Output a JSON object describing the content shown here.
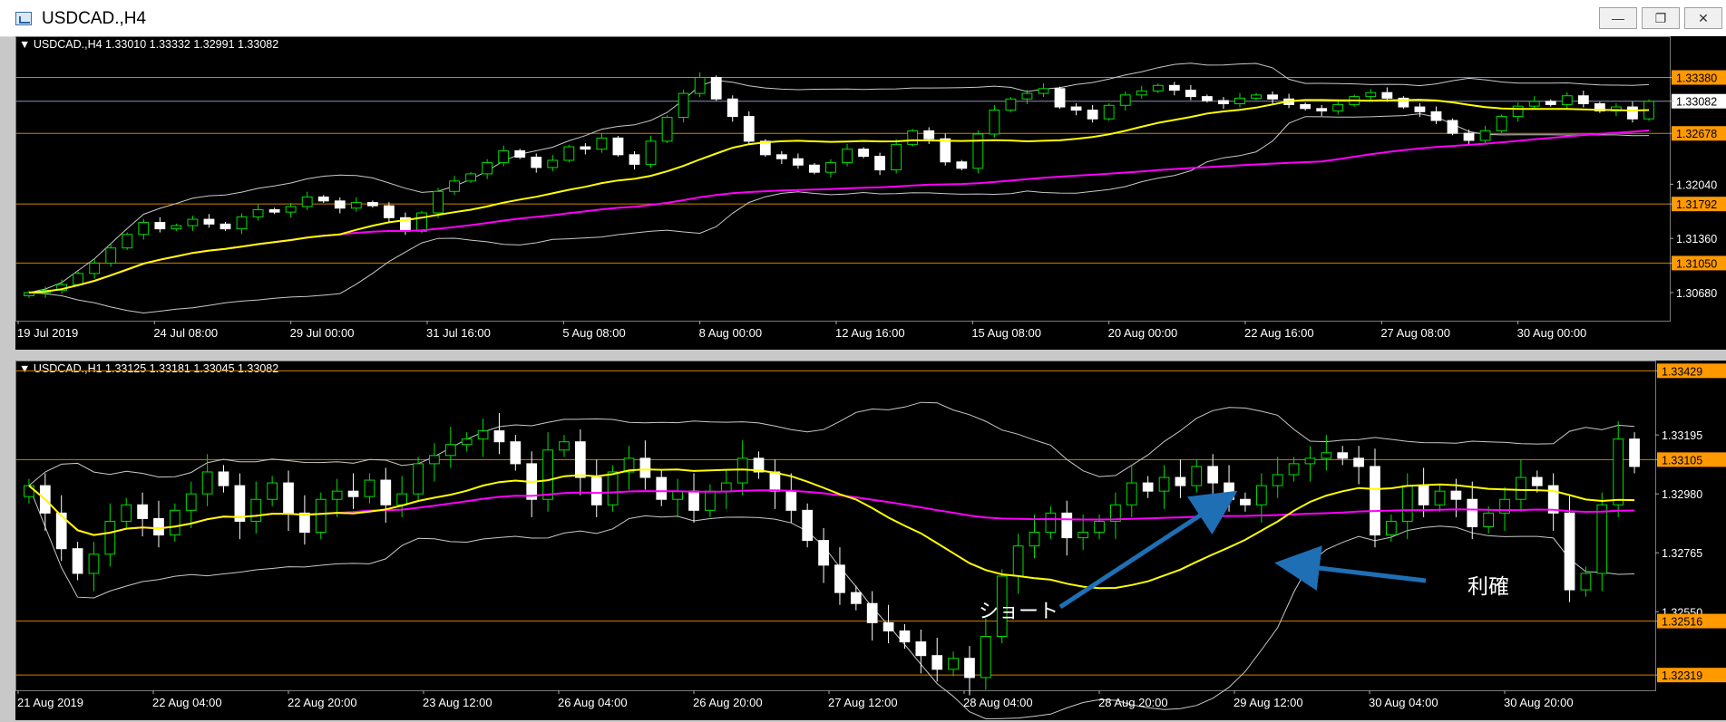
{
  "window": {
    "title": "USDCAD.,H4",
    "buttons": [
      "minimize",
      "restore",
      "close"
    ]
  },
  "annotations": {
    "short_label": "ショート",
    "take_profit_label": "利確"
  },
  "colors": {
    "bull_candle": "#00e000",
    "bear_candle": "#ffffff",
    "ma_fast": "#ffff00",
    "ma_slow": "#ff00ff",
    "bands": "#c8c8c8",
    "level_line": "#d08000",
    "price_box": "#ff9900",
    "arrow": "#1f6fb5"
  },
  "chart_data": [
    {
      "type": "candlestick",
      "header": "USDCAD.,H4  1.33010 1.33332 1.32991 1.33082",
      "x_ticks": [
        "19 Jul 2019",
        "24 Jul 08:00",
        "29 Jul 00:00",
        "31 Jul 16:00",
        "5 Aug 08:00",
        "8 Aug 00:00",
        "12 Aug 16:00",
        "15 Aug 08:00",
        "20 Aug 00:00",
        "22 Aug 16:00",
        "27 Aug 08:00",
        "30 Aug 00:00"
      ],
      "y_ticks": [
        "1.33380",
        "1.33082",
        "1.32678",
        "1.32040",
        "1.31792",
        "1.31360",
        "1.31050",
        "1.30680"
      ],
      "highlighted_prices": [
        "1.33380",
        "1.32678",
        "1.31792",
        "1.31050"
      ],
      "current_price": "1.33082",
      "ylim": [
        1.3035,
        1.3367
      ],
      "horizontal_levels": [
        1.3338,
        1.32678,
        1.31792,
        1.3105
      ],
      "close": [
        1.3068,
        1.3071,
        1.3078,
        1.3092,
        1.3105,
        1.3124,
        1.3141,
        1.3156,
        1.3148,
        1.3152,
        1.316,
        1.3154,
        1.3148,
        1.3163,
        1.3172,
        1.3169,
        1.3176,
        1.3188,
        1.3183,
        1.3174,
        1.3181,
        1.3177,
        1.3162,
        1.3145,
        1.3168,
        1.3195,
        1.3208,
        1.3217,
        1.3231,
        1.3246,
        1.3238,
        1.3225,
        1.3234,
        1.3251,
        1.3248,
        1.3262,
        1.3241,
        1.3229,
        1.3258,
        1.3288,
        1.3318,
        1.3338,
        1.3311,
        1.3289,
        1.3258,
        1.3241,
        1.3236,
        1.3228,
        1.3219,
        1.3231,
        1.3248,
        1.3239,
        1.3222,
        1.3254,
        1.3271,
        1.3261,
        1.3232,
        1.3224,
        1.3267,
        1.3297,
        1.3311,
        1.3318,
        1.3324,
        1.3301,
        1.3297,
        1.3286,
        1.3303,
        1.3316,
        1.3321,
        1.3328,
        1.3322,
        1.3314,
        1.3309,
        1.3305,
        1.3312,
        1.3316,
        1.3311,
        1.3304,
        1.3299,
        1.3296,
        1.3304,
        1.3314,
        1.3319,
        1.3312,
        1.3301,
        1.3295,
        1.3284,
        1.3268,
        1.3259,
        1.3271,
        1.3289,
        1.3302,
        1.3308,
        1.3304,
        1.3315,
        1.3305,
        1.3296,
        1.3301,
        1.3286,
        1.3308
      ]
    },
    {
      "type": "candlestick",
      "header": "USDCAD.,H1  1.33125 1.33181 1.33045 1.33082",
      "x_ticks": [
        "21 Aug 2019",
        "22 Aug 04:00",
        "22 Aug 20:00",
        "23 Aug 12:00",
        "26 Aug 04:00",
        "26 Aug 20:00",
        "27 Aug 12:00",
        "28 Aug 04:00",
        "28 Aug 20:00",
        "29 Aug 12:00",
        "30 Aug 04:00",
        "30 Aug 20:00"
      ],
      "y_ticks": [
        "1.33429",
        "1.33195",
        "1.33105",
        "1.32980",
        "1.32765",
        "1.32550",
        "1.32516",
        "1.32319"
      ],
      "highlighted_prices": [
        "1.33429",
        "1.33105",
        "1.32516",
        "1.32319"
      ],
      "current_price": "1.33082",
      "ylim": [
        1.3227,
        1.3344
      ],
      "horizontal_levels": [
        1.33105,
        1.32516,
        1.32319
      ],
      "close": [
        1.3301,
        1.3291,
        1.3278,
        1.3269,
        1.3276,
        1.3288,
        1.3294,
        1.3289,
        1.3283,
        1.3292,
        1.3298,
        1.3306,
        1.3301,
        1.3288,
        1.3296,
        1.3302,
        1.3291,
        1.3284,
        1.3296,
        1.3299,
        1.3297,
        1.3303,
        1.3294,
        1.3298,
        1.3309,
        1.3312,
        1.3316,
        1.3318,
        1.3321,
        1.3317,
        1.3309,
        1.3296,
        1.3314,
        1.3317,
        1.3304,
        1.3294,
        1.3306,
        1.3311,
        1.3304,
        1.3296,
        1.3299,
        1.3292,
        1.3299,
        1.3302,
        1.3311,
        1.3306,
        1.3299,
        1.3292,
        1.3281,
        1.3272,
        1.3262,
        1.3258,
        1.3251,
        1.3248,
        1.3244,
        1.3239,
        1.3234,
        1.3238,
        1.3231,
        1.3246,
        1.3268,
        1.3279,
        1.3284,
        1.3291,
        1.3282,
        1.3284,
        1.3288,
        1.3294,
        1.3302,
        1.3299,
        1.3304,
        1.3301,
        1.3308,
        1.3302,
        1.3296,
        1.3294,
        1.3301,
        1.3305,
        1.3309,
        1.3311,
        1.3313,
        1.3311,
        1.3308,
        1.3283,
        1.3288,
        1.3301,
        1.3294,
        1.3299,
        1.3296,
        1.3286,
        1.3291,
        1.3296,
        1.3304,
        1.3301,
        1.3291,
        1.3263,
        1.3269,
        1.3294,
        1.3318,
        1.3308
      ]
    }
  ]
}
